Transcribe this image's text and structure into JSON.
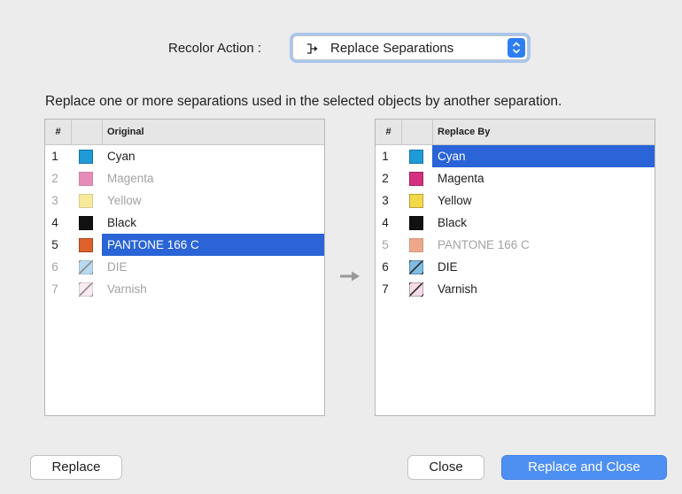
{
  "header": {
    "recolor_label": "Recolor Action :",
    "action_value": "Replace Separations",
    "action_icon": "replace-icon"
  },
  "description": "Replace one or more separations used in the selected objects by another separation.",
  "original_table": {
    "col_num": "#",
    "col_name": "Original",
    "rows": [
      {
        "num": "1",
        "name": "Cyan",
        "color": "#1e9bd7",
        "dim": false,
        "selected": false,
        "pattern": "solid"
      },
      {
        "num": "2",
        "name": "Magenta",
        "color": "#d4307f",
        "dim": true,
        "selected": false,
        "pattern": "solid"
      },
      {
        "num": "3",
        "name": "Yellow",
        "color": "#f3d94a",
        "dim": true,
        "selected": false,
        "pattern": "solid"
      },
      {
        "num": "4",
        "name": "Black",
        "color": "#111111",
        "dim": false,
        "selected": false,
        "pattern": "solid"
      },
      {
        "num": "5",
        "name": "PANTONE 166 C",
        "color": "#e0612a",
        "dim": false,
        "selected": true,
        "pattern": "solid"
      },
      {
        "num": "6",
        "name": "DIE",
        "color": "#7fbde4",
        "dim": true,
        "selected": false,
        "pattern": "die"
      },
      {
        "num": "7",
        "name": "Varnish",
        "color": "#f6dbe8",
        "dim": true,
        "selected": false,
        "pattern": "varnish"
      }
    ]
  },
  "replace_table": {
    "col_num": "#",
    "col_name": "Replace By",
    "rows": [
      {
        "num": "1",
        "name": "Cyan",
        "color": "#1e9bd7",
        "dim": false,
        "selected": true,
        "pattern": "solid"
      },
      {
        "num": "2",
        "name": "Magenta",
        "color": "#d4307f",
        "dim": false,
        "selected": false,
        "pattern": "solid"
      },
      {
        "num": "3",
        "name": "Yellow",
        "color": "#f3d94a",
        "dim": false,
        "selected": false,
        "pattern": "solid"
      },
      {
        "num": "4",
        "name": "Black",
        "color": "#111111",
        "dim": false,
        "selected": false,
        "pattern": "solid"
      },
      {
        "num": "5",
        "name": "PANTONE 166 C",
        "color": "#e0612a",
        "dim": true,
        "selected": false,
        "pattern": "solid"
      },
      {
        "num": "6",
        "name": "DIE",
        "color": "#7fbde4",
        "dim": false,
        "selected": false,
        "pattern": "die"
      },
      {
        "num": "7",
        "name": "Varnish",
        "color": "#f6dbe8",
        "dim": false,
        "selected": false,
        "pattern": "varnish"
      }
    ]
  },
  "buttons": {
    "replace": "Replace",
    "close": "Close",
    "replace_and_close": "Replace and Close"
  },
  "colors": {
    "selection": "#2a64d6",
    "primary_button": "#4e8ff2",
    "dialog_bg": "#ececec"
  },
  "icons": {
    "transfer_arrow": "right-arrow-icon",
    "popup_stepper": "chevron-updown-icon"
  }
}
